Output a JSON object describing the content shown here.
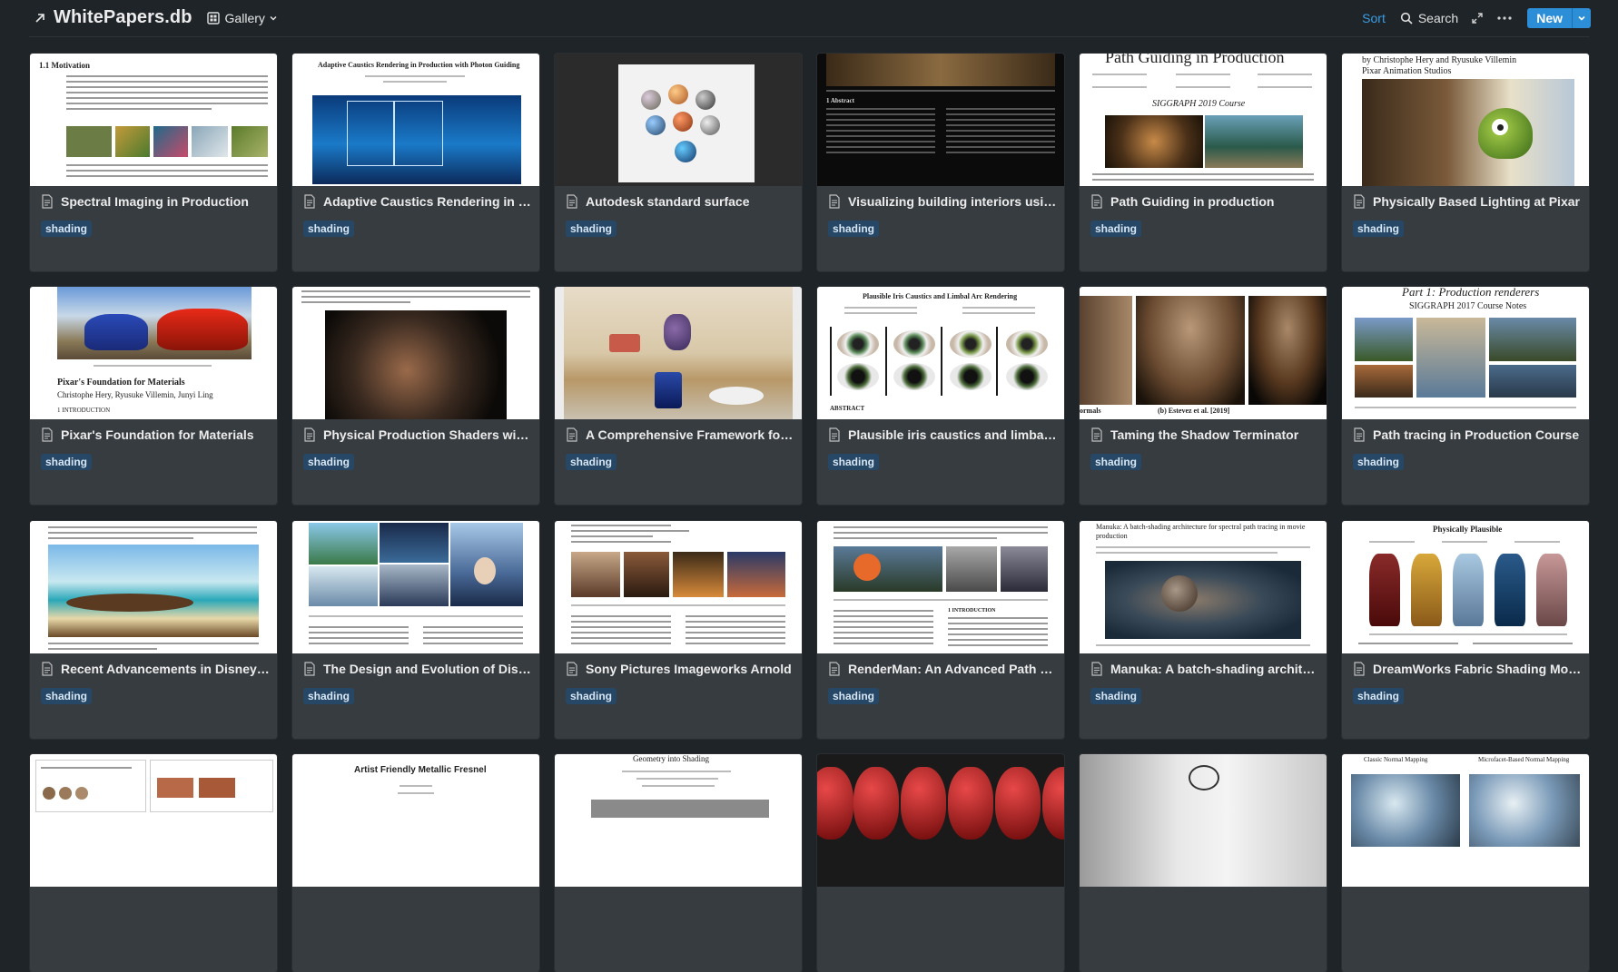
{
  "header": {
    "title": "WhitePapers.db",
    "view_label": "Gallery",
    "sort_label": "Sort",
    "search_label": "Search",
    "new_label": "New"
  },
  "colors": {
    "background": "#1f2428",
    "card": "#373c40",
    "accent": "#2d8ed8",
    "tag_bg": "#264766"
  },
  "cards": [
    {
      "title": "Spectral Imaging in Production",
      "tag": "shading",
      "thumb_heading": "1.1    Motivation"
    },
    {
      "title": "Adaptive Caustics Rendering in Production with Photon Guiding",
      "tag": "shading",
      "thumb_heading": "Adaptive Caustics Rendering in Production with Photon Guiding"
    },
    {
      "title": "Autodesk standard surface",
      "tag": "shading"
    },
    {
      "title": "Visualizing building interiors using virtual windows",
      "tag": "shading",
      "thumb_heading": "1 Abstract"
    },
    {
      "title": "Path Guiding in production",
      "tag": "shading",
      "thumb_heading": "Path Guiding in Production",
      "thumb_subheading": "SIGGRAPH 2019 Course"
    },
    {
      "title": "Physically Based Lighting at Pixar",
      "tag": "shading",
      "thumb_heading": "by Christophe Hery and Ryusuke Villemin",
      "thumb_subheading": "Pixar Animation Studios"
    },
    {
      "title": "Pixar's Foundation for Materials",
      "tag": "shading",
      "thumb_heading": "Pixar's Foundation for Materials",
      "thumb_subheading": "Christophe Hery, Ryusuke Villemin, Junyi Ling",
      "thumb_section": "1    INTRODUCTION"
    },
    {
      "title": "Physical Production Shaders with OSL",
      "tag": "shading"
    },
    {
      "title": "A Comprehensive Framework for Rendering Layered Materials",
      "tag": "shading"
    },
    {
      "title": "Plausible iris caustics and limbal arc rendering",
      "tag": "shading",
      "thumb_heading": "Plausible Iris Caustics and Limbal Arc Rendering",
      "thumb_section": "ABSTRACT"
    },
    {
      "title": "Taming the Shadow Terminator",
      "tag": "shading",
      "thumb_caption": "(b) Estevez et al. [2019]",
      "thumb_caption_left": "ormals"
    },
    {
      "title": "Path tracing in Production Course",
      "tag": "shading",
      "thumb_heading": "Part 1: Production renderers",
      "thumb_subheading": "SIGGRAPH 2017 Course Notes"
    },
    {
      "title": "Recent Advancements in Disney's Hyperion Renderer",
      "tag": "shading"
    },
    {
      "title": "The Design and Evolution of Disney's Hyperion Renderer",
      "tag": "shading"
    },
    {
      "title": "Sony Pictures Imageworks Arnold",
      "tag": "shading"
    },
    {
      "title": "RenderMan: An Advanced Path Tracing Architecture for Movie Rendering",
      "tag": "shading",
      "thumb_section": "1    INTRODUCTION"
    },
    {
      "title": "Manuka: A batch-shading architecture for spectral path tracing in movie production",
      "tag": "shading",
      "thumb_heading": "Manuka: A batch-shading architecture for spectral path tracing in movie production"
    },
    {
      "title": "DreamWorks Fabric Shading Model",
      "tag": "shading",
      "thumb_heading": "Physically Plausible"
    },
    {
      "title": "",
      "tag": ""
    },
    {
      "title": "",
      "tag": "",
      "thumb_heading": "Artist Friendly Metallic Fresnel"
    },
    {
      "title": "",
      "tag": "",
      "thumb_heading": "Geometry into Shading"
    },
    {
      "title": "",
      "tag": ""
    },
    {
      "title": "",
      "tag": ""
    },
    {
      "title": "",
      "tag": "",
      "thumb_heading": "Classic Normal Mapping",
      "thumb_subheading": "Microfacet-Based Normal Mapping"
    }
  ]
}
